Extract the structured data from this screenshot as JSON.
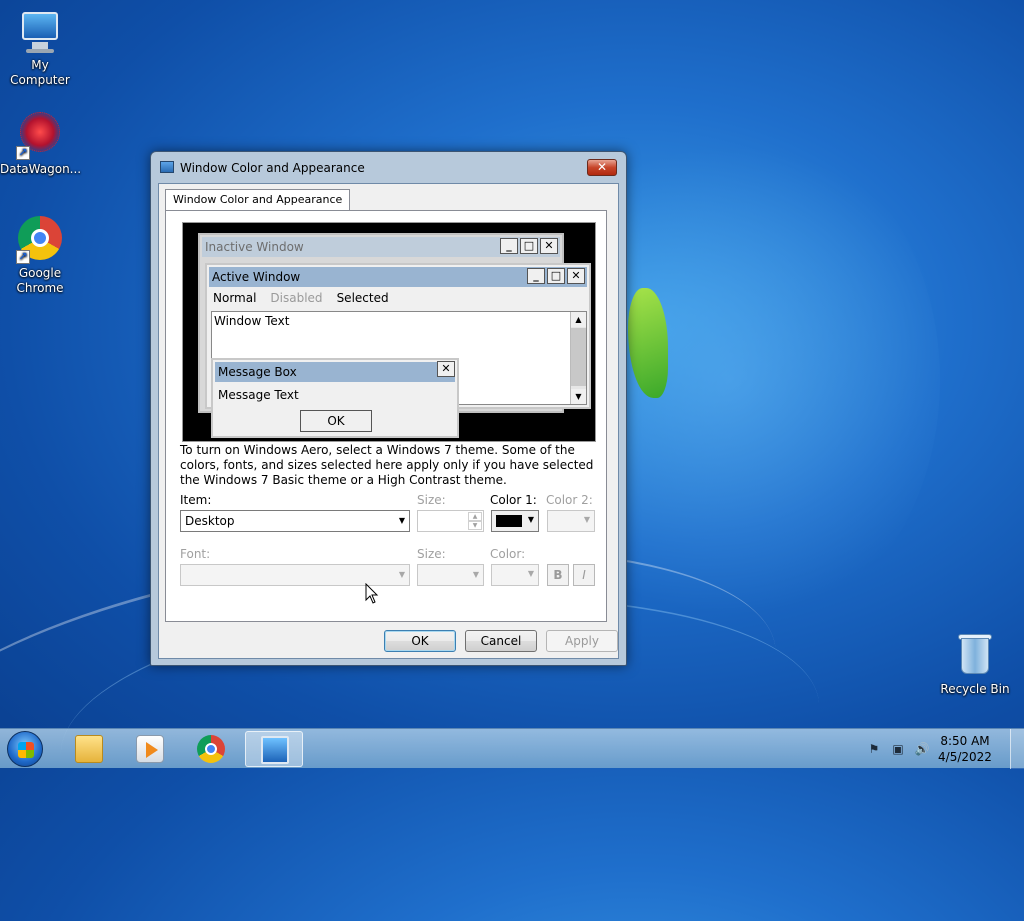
{
  "desktop": {
    "icons": [
      {
        "label": "My Computer"
      },
      {
        "label": "DataWagon..."
      },
      {
        "label": "Google Chrome"
      },
      {
        "label": "Recycle Bin"
      }
    ]
  },
  "dialog": {
    "title": "Window Color and Appearance",
    "close_glyph": "✕",
    "tab_label": "Window Color and Appearance",
    "preview": {
      "inactive_title": "Inactive Window",
      "active_title": "Active Window",
      "menu_normal": "Normal",
      "menu_disabled": "Disabled",
      "menu_selected": "Selected",
      "window_text": "Window Text",
      "msgbox_title": "Message Box",
      "msgbox_text": "Message Text",
      "msgbox_ok": "OK",
      "min_glyph": "_",
      "max_glyph": "□",
      "close_glyph": "✕"
    },
    "info_text": "To turn on Windows Aero, select a Windows 7 theme.  Some of the colors, fonts, and sizes selected here apply only if you have selected the Windows 7 Basic theme or a High Contrast theme.",
    "item_label": "Item:",
    "item_value": "Desktop",
    "size_label": "Size:",
    "color1_label": "Color 1:",
    "color1_value": "#000000",
    "color2_label": "Color 2:",
    "font_label": "Font:",
    "font_size_label": "Size:",
    "font_color_label": "Color:",
    "bold_label": "B",
    "italic_label": "I",
    "ok_label": "OK",
    "cancel_label": "Cancel",
    "apply_label": "Apply"
  },
  "taskbar": {
    "items": [
      {
        "name": "windows-explorer",
        "icon": "folder-icon"
      },
      {
        "name": "media-player",
        "icon": "media-player-icon"
      },
      {
        "name": "google-chrome",
        "icon": "chrome-icon"
      },
      {
        "name": "display-settings",
        "icon": "display-icon",
        "active": true
      }
    ],
    "tray_icons": [
      "action-center-icon",
      "network-icon",
      "volume-icon"
    ],
    "time": "8:50 AM",
    "date": "4/5/2022"
  }
}
